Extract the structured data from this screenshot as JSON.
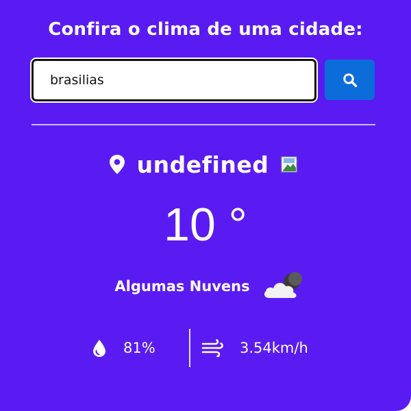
{
  "header": {
    "title": "Confira o clima de uma cidade:"
  },
  "search": {
    "value": "brasilias",
    "button_icon": "search-icon"
  },
  "weather": {
    "city": "undefined",
    "temperature": "10 °",
    "description": "Algumas Nuvens",
    "condition_icon": "cloud-moon-icon",
    "humidity": "81%",
    "wind_speed": "3.54km/h"
  },
  "colors": {
    "background": "#5a1bf2",
    "button": "#0c6cd9",
    "text": "#ffffff"
  }
}
